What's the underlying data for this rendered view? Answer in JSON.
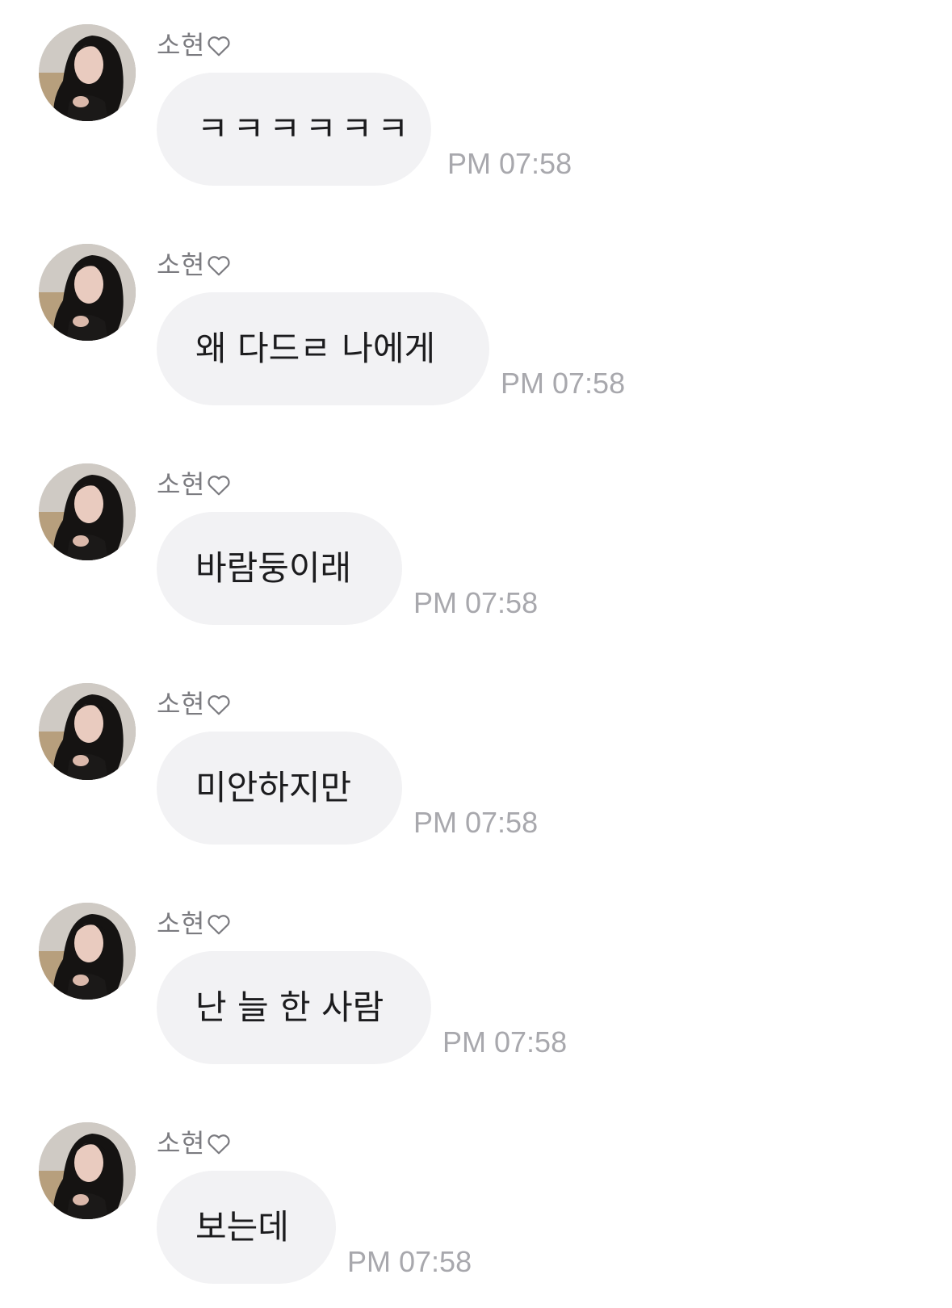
{
  "messages": [
    {
      "sender": "소현",
      "text": "ㅋㅋㅋㅋㅋㅋ",
      "time": "PM 07:58"
    },
    {
      "sender": "소현",
      "text": "왜 다드ㄹ 나에게",
      "time": "PM 07:58"
    },
    {
      "sender": "소현",
      "text": "바람둥이래",
      "time": "PM 07:58"
    },
    {
      "sender": "소현",
      "text": "미안하지만",
      "time": "PM 07:58"
    },
    {
      "sender": "소현",
      "text": "난 늘 한 사람",
      "time": "PM 07:58"
    },
    {
      "sender": "소현",
      "text": "보는데",
      "time": "PM 07:58"
    }
  ],
  "icons": {
    "avatar": "profile-photo",
    "name_suffix": "heart-outline-icon"
  },
  "colors": {
    "bubble": "#f2f2f4",
    "message_text": "#1c1c1e",
    "sender_text": "#7b7b80",
    "time_text": "#a8a8ad",
    "background": "#ffffff"
  }
}
